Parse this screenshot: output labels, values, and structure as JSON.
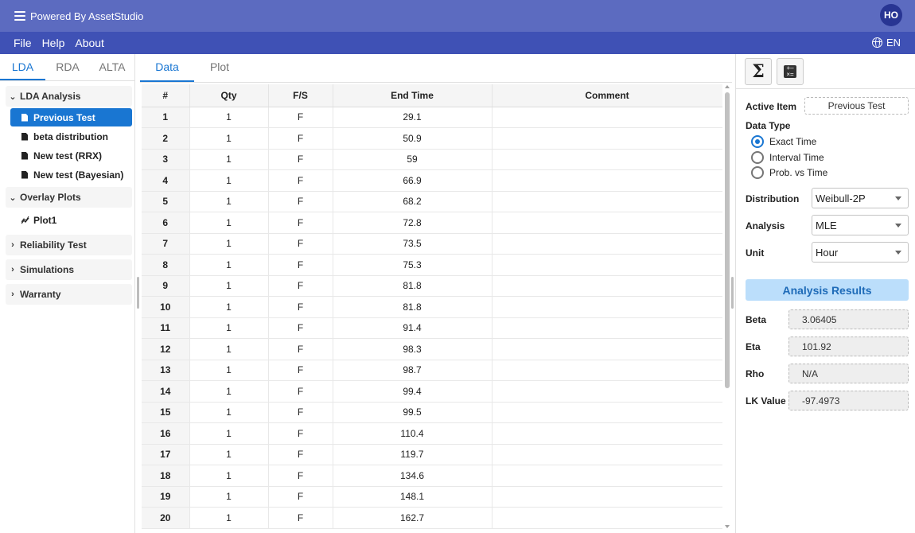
{
  "app": {
    "title": "Powered By AssetStudio",
    "avatar_initials": "HO"
  },
  "menubar": {
    "file": "File",
    "help": "Help",
    "about": "About",
    "language": "EN"
  },
  "sidebar": {
    "tabs": [
      "LDA",
      "RDA",
      "ALTA"
    ],
    "active_tab": "LDA",
    "groups": {
      "lda_analysis": "LDA Analysis",
      "overlay_plots": "Overlay Plots",
      "reliability_test": "Reliability Test",
      "simulations": "Simulations",
      "warranty": "Warranty"
    },
    "lda_items": [
      "Previous Test",
      "beta distribution",
      "New test (RRX)",
      "New test (Bayesian)"
    ],
    "overlay_items": [
      "Plot1"
    ],
    "selected_item": "Previous Test"
  },
  "main": {
    "tabs": [
      "Data",
      "Plot"
    ],
    "active_tab": "Data",
    "columns": [
      "#",
      "Qty",
      "F/S",
      "End Time",
      "Comment"
    ],
    "rows": [
      [
        "1",
        "1",
        "F",
        "29.1",
        ""
      ],
      [
        "2",
        "1",
        "F",
        "50.9",
        ""
      ],
      [
        "3",
        "1",
        "F",
        "59",
        ""
      ],
      [
        "4",
        "1",
        "F",
        "66.9",
        ""
      ],
      [
        "5",
        "1",
        "F",
        "68.2",
        ""
      ],
      [
        "6",
        "1",
        "F",
        "72.8",
        ""
      ],
      [
        "7",
        "1",
        "F",
        "73.5",
        ""
      ],
      [
        "8",
        "1",
        "F",
        "75.3",
        ""
      ],
      [
        "9",
        "1",
        "F",
        "81.8",
        ""
      ],
      [
        "10",
        "1",
        "F",
        "81.8",
        ""
      ],
      [
        "11",
        "1",
        "F",
        "91.4",
        ""
      ],
      [
        "12",
        "1",
        "F",
        "98.3",
        ""
      ],
      [
        "13",
        "1",
        "F",
        "98.7",
        ""
      ],
      [
        "14",
        "1",
        "F",
        "99.4",
        ""
      ],
      [
        "15",
        "1",
        "F",
        "99.5",
        ""
      ],
      [
        "16",
        "1",
        "F",
        "110.4",
        ""
      ],
      [
        "17",
        "1",
        "F",
        "119.7",
        ""
      ],
      [
        "18",
        "1",
        "F",
        "134.6",
        ""
      ],
      [
        "19",
        "1",
        "F",
        "148.1",
        ""
      ],
      [
        "20",
        "1",
        "F",
        "162.7",
        ""
      ]
    ]
  },
  "right": {
    "active_item_label": "Active Item",
    "active_item_value": "Previous Test",
    "data_type_label": "Data Type",
    "data_types": [
      "Exact Time",
      "Interval Time",
      "Prob. vs Time"
    ],
    "selected_data_type": "Exact Time",
    "distribution_label": "Distribution",
    "distribution_value": "Weibull-2P",
    "analysis_label": "Analysis",
    "analysis_value": "MLE",
    "unit_label": "Unit",
    "unit_value": "Hour",
    "results_header": "Analysis Results",
    "results": {
      "beta_label": "Beta",
      "beta_value": "3.06405",
      "eta_label": "Eta",
      "eta_value": "101.92",
      "rho_label": "Rho",
      "rho_value": "N/A",
      "lk_label": "LK Value",
      "lk_value": "-97.4973"
    }
  },
  "colors": {
    "appbar": "#5c6bc0",
    "menubar": "#3f51b5",
    "accent": "#1976d2",
    "results_header_bg": "#bbdefb"
  }
}
